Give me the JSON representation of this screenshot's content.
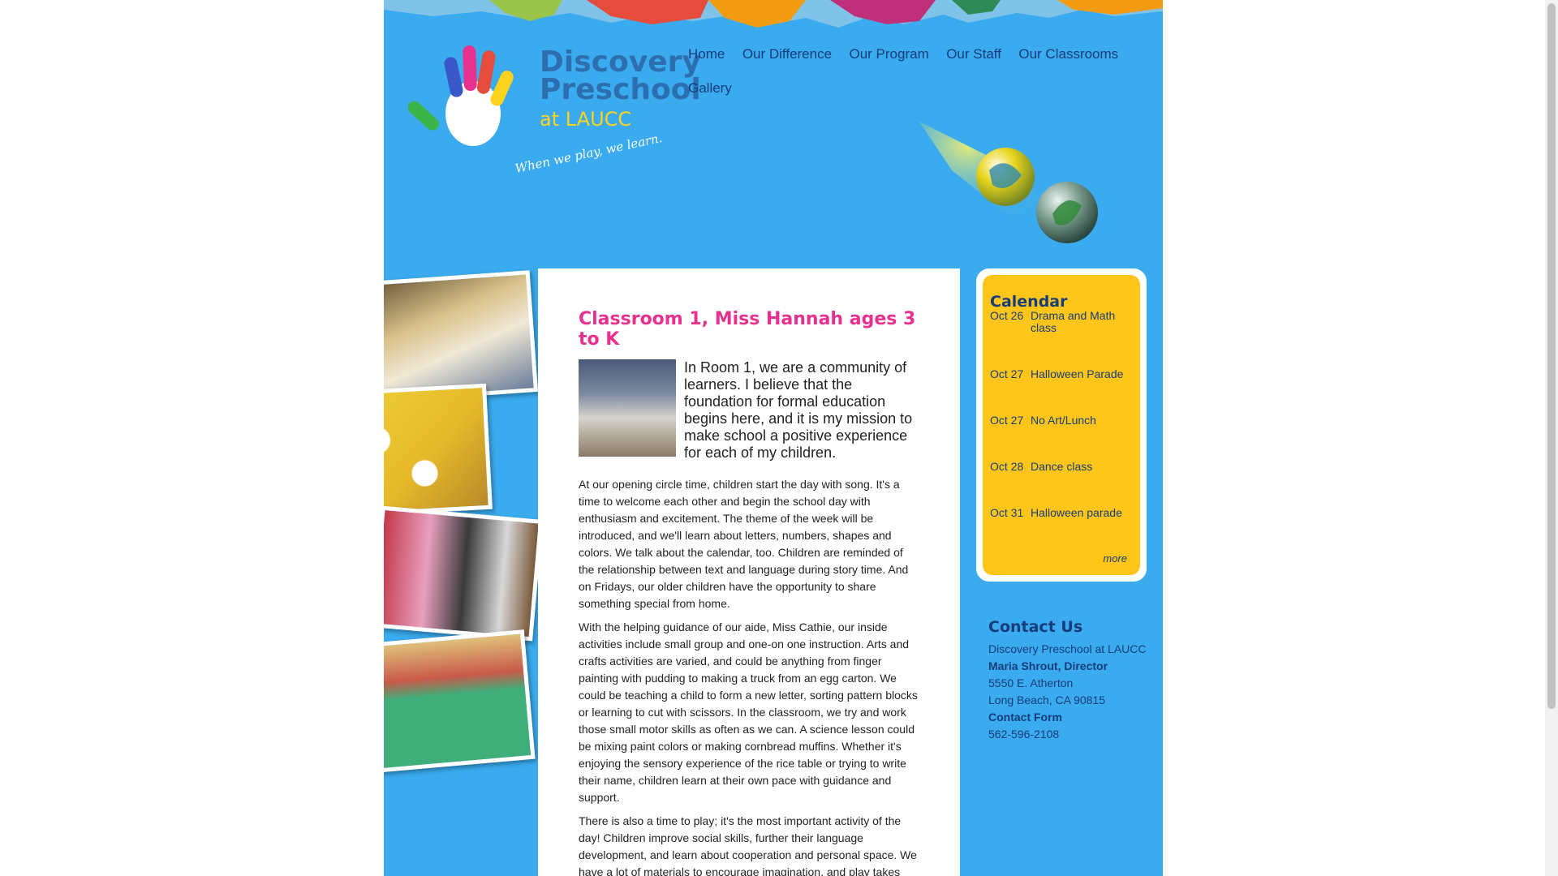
{
  "colors": {
    "page_bg": "#ffffff",
    "main_blue": "#3aabee",
    "nav_text": "#163c7a",
    "title_pink": "#e8308f",
    "calendar_yellow": "#ffc619",
    "logo_blue": "#2d6fae",
    "logo_yellow": "#ffd21e"
  },
  "logo": {
    "line1": "Discovery",
    "line2": "Preschool",
    "line3": "at LAUCC",
    "tagline": "When we play, we learn.",
    "icon": "handprint-logo"
  },
  "nav": {
    "items": [
      {
        "label": "Home"
      },
      {
        "label": "Our Difference"
      },
      {
        "label": "Our Program"
      },
      {
        "label": "Our Staff"
      },
      {
        "label": "Our Classrooms"
      },
      {
        "label": "Gallery"
      }
    ]
  },
  "content": {
    "title": "Classroom 1, Miss Hannah ages 3 to K",
    "intro": "In Room 1, we are a community of learners. I believe that the foundation for formal education begins here, and it is my mission to make school a positive experience for each of my children.",
    "paragraphs": [
      "At our opening circle time, children start the day with song. It's a time to welcome each other and begin the school day with enthusiasm and excitement. The theme of the week will be introduced, and we'll learn about letters, numbers, shapes and colors. We talk about the calendar, too. Children are reminded of the relationship between text and language during story time. And on Fridays, our older children have the opportunity to share something special from home.",
      "With the helping guidance of our aide, Miss Cathie, our inside activities include small group and one-on one instruction. Arts and crafts activities are varied, and could be anything from finger painting with pudding to making a truck from an egg carton. We could be teaching a child to form a new letter, sorting pattern blocks or learning to cut with scissors. In the classroom, we try and work those small motor skills as often as we can. A science lesson could be mixing paint colors or making cornbread muffins. Whether it's enjoying the sensory experience of the rice table or trying to write their name, children learn at their own pace with guidance and support.",
      "There is also a time to play; it's the most important activity of the day! Children improve social skills, further their language development, and learn about cooperation and personal space. We have a lot of materials to encourage imagination, and play takes place both inside and out."
    ]
  },
  "calendar": {
    "title": "Calendar",
    "events": [
      {
        "date": "Oct 26",
        "event": "Drama and Math class"
      },
      {
        "date": "Oct 27",
        "event": "Halloween Parade"
      },
      {
        "date": "Oct 27",
        "event": "No Art/Lunch"
      },
      {
        "date": "Oct 28",
        "event": "Dance class"
      },
      {
        "date": "Oct 31",
        "event": "Halloween parade"
      }
    ],
    "more_label": "more"
  },
  "contact": {
    "title": "Contact Us",
    "org": "Discovery Preschool at LAUCC",
    "director": "Maria Shrout, Director",
    "street": "5550 E. Atherton",
    "city": "Long Beach, CA 90815",
    "form_label": "Contact Form",
    "phone": "562-596-2108"
  }
}
